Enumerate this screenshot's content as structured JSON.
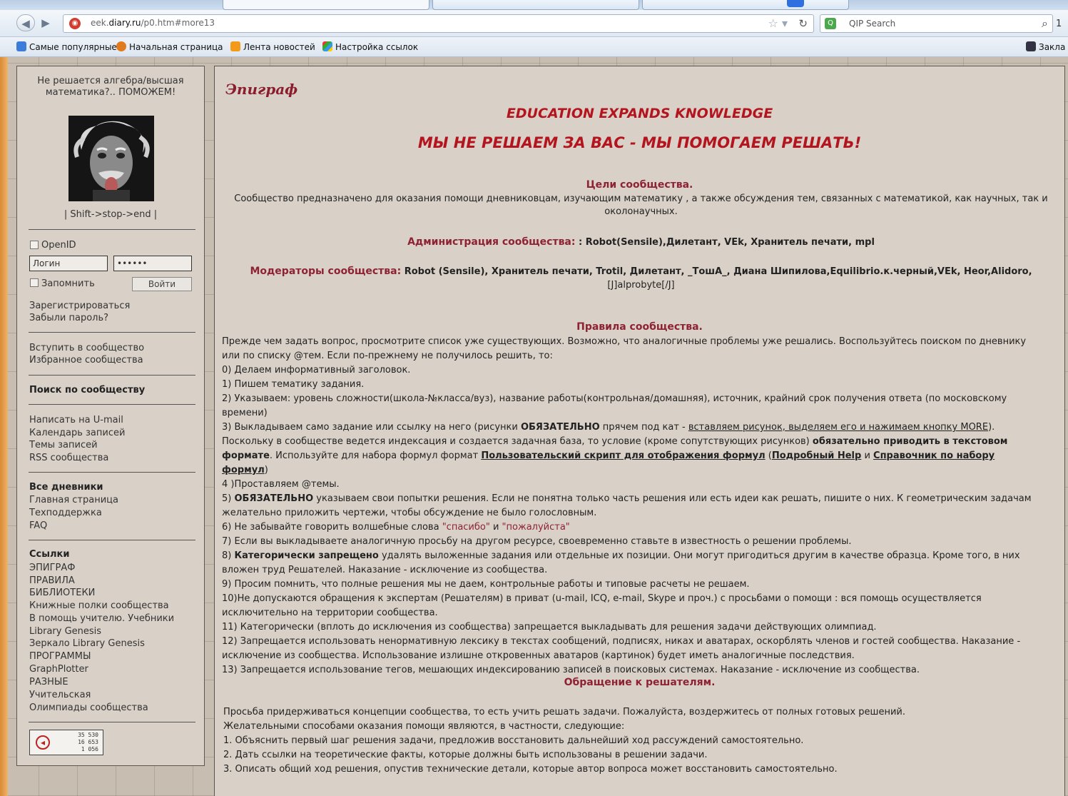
{
  "browser": {
    "url_prefix": "eek.",
    "url_domain": "diary.ru",
    "url_path": "/p0.htm#more13",
    "search_placeholder": "QIP Search",
    "extra_button": "1",
    "bookmarks": [
      "Самые популярные",
      "Начальная страница",
      "Лента новостей",
      "Настройка ссылок"
    ],
    "bookmarks_right": "Закла"
  },
  "sidebar": {
    "tagline": "Не решается алгебра/высшая математика?.. ПОМОЖЕМ!",
    "signature": "| Shift->stop->end |",
    "openid_label": "OpenID",
    "login_placeholder": "Логин",
    "password_value": "••••••",
    "remember_label": "Запомнить",
    "login_button": "Войти",
    "register": "Зарегистрироваться",
    "forgot": "Забыли пароль?",
    "join": "Вступить в сообщество",
    "favorites": "Избранное сообщества",
    "search_heading": "Поиск по сообществу",
    "umail": "Написать на U-mail",
    "calendar": "Календарь записей",
    "topics": "Темы записей",
    "rss": "RSS сообщества",
    "all_diaries_heading": "Все дневники",
    "main_page": "Главная страница",
    "support": "Техподдержка",
    "faq": "FAQ",
    "links_heading": "Ссылки",
    "links": [
      "ЭПИГРАФ",
      "ПРАВИЛА",
      "БИБЛИОТЕКИ",
      "Книжные полки сообщества",
      "В помощь учителю. Учебники",
      "Library Genesis",
      "Зеркало Library Genesis",
      "ПРОГРАММЫ",
      "GraphPlotter",
      "РАЗНЫЕ",
      "Учительская",
      "Олимпиады сообщества"
    ],
    "counter": [
      "35 530",
      "16 653",
      "1 056"
    ]
  },
  "content": {
    "epigraph": "Эпиграф",
    "banner1": "EDUCATION EXPANDS KNOWLEDGE",
    "banner2": "МЫ НЕ РЕШАЕМ ЗА ВАС - МЫ ПОМОГАЕМ РЕШАТЬ!",
    "goals_title": "Цели сообщества.",
    "goals_text": "Сообщество предназначено для оказания помощи дневниковцам, изучающим математику , а также обсуждения тем, связанных с математикой, как научных, так и околонаучных.",
    "admin_label": "Администрация сообщества:",
    "admin_names": " : Robot(Sensile),Дилетант, VEk, Хранитель печати, mpl",
    "mods_label": "Модераторы сообщества:",
    "mods_names": " Robot (Sensile), Хранитель печати, Trotil, Дилетант, _ТошА_, Диана Шипилова,Equilibrio.к.черный,VEk, Heor,Alidoro,",
    "mods_tail": "[J]alprobyte[/J]",
    "rules_title": "Правила сообщества.",
    "rules_intro1": "Прежде чем задать вопрос, просмотрите список уже существующих. Возможно, что аналогичные проблемы уже решались. Воспользуйтесь поиском по дневнику",
    "rules_intro2": "или по списку @тем. Если по-прежнему не получилось решить, то:",
    "r0": "0) Делаем информативный заголовок.",
    "r1": "1) Пишем тематику задания.",
    "r2a": "2) Указываем: уровень сложности(школа-№класса/вуз), название работы(контрольная/домашняя), источник, крайний срок получения ответа (по московскому",
    "r2b": "времени)",
    "r3_a": "3) Выкладываем само задание или ссылку на него (рисунки ",
    "r3_bold": "ОБЯЗАТЕЛЬНО",
    "r3_b": " прячем под кат - ",
    "r3_link": "вставляем рисунок, выделяем его и нажимаем кнопку MORE",
    "r3_c": ").",
    "r3_line2a": "Поскольку в сообществе ведется индексация и создается задачная база, то условие (кроме сопутствующих рисунков) ",
    "r3_line2bold": "обязательно приводить в текстовом",
    "r3_line3bold": "формате",
    "r3_line3a": ". Используйте для набора формул формат ",
    "r3_link2": "Пользовательский скрипт для отображения формул",
    "r3_line3b": " (",
    "r3_link3": "Подробный Help",
    "r3_line3c": " и ",
    "r3_link4": "Справочник по набору",
    "r3_link4b": "формул",
    "r3_line4": ")",
    "r4": "4 )Проставляем @темы.",
    "r5_bold": "ОБЯЗАТЕЛЬНО",
    "r5a": "5) ",
    "r5b": " указываем свои попытки решения. Если не понятна только часть решения или есть идеи как решать, пишите о них. К геометрическим задачам",
    "r5c": "желательно приложить чертежи, чтобы обсуждение не было голословным.",
    "r6a": "6) Не забывайте говорить волшебные слова ",
    "r6q1": "\"спасибо\"",
    "r6and": " и ",
    "r6q2": "\"пожалуйста\"",
    "r7": "7) Если вы выкладываете аналогичную просьбу на другом ресурсе, своевременно ставьте в известность о решении проблемы.",
    "r8a": "8) ",
    "r8bold": "Категорически запрещено",
    "r8b": " удалять выложенные задания или отдельные их позиции. Они могут пригодиться другим в качестве образца. Кроме того, в них",
    "r8c": "вложен труд Решателей. Наказание - исключение из сообщества.",
    "r9": "9) Просим помнить, что полные решения мы не даем, контрольные работы и типовые расчеты не решаем.",
    "r10a": "10)Не допускаются обращения к экспертам (Решателям) в приват (u-mail, ICQ, e-mail, Skype и проч.) с просьбами о помощи : вся помощь осуществляется",
    "r10b": "исключительно на территории сообщества.",
    "r11": "11) Категорически (вплоть до исключения из сообщества) запрещается выкладывать для решения задачи действующих олимпиад.",
    "r12a": "12) Запрещается использовать ненормативную лексику в текстах сообщений, подписях, никах и аватарах, оскорблять членов и гостей сообщества. Наказание -",
    "r12b": "исключение из сообщества. Использование излишне откровенных аватаров (картинок) будет иметь аналогичные последствия.",
    "r13": "13) Запрещается использование тегов, мешающих индексированию записей в поисковых системах. Наказание - исключение из сообщества.",
    "appeal_title": "Обращение к решателям.",
    "a0": "Просьба придерживаться концепции сообщества, то есть учить решать задачи. Пожалуйста, воздержитесь от полных готовых решений.",
    "a1": "Желательными способами оказания помощи являются, в частности, следующие:",
    "a2": "1. Объяснить первый шаг решения задачи, предложив восстановить дальнейший ход рассуждений самостоятельно.",
    "a3": "2. Дать ссылки на теоретические факты, которые должны быть использованы в решении задачи.",
    "a4": "3. Описать общий ход решения, опустив технические детали, которые автор вопроса может восстановить самостоятельно."
  }
}
